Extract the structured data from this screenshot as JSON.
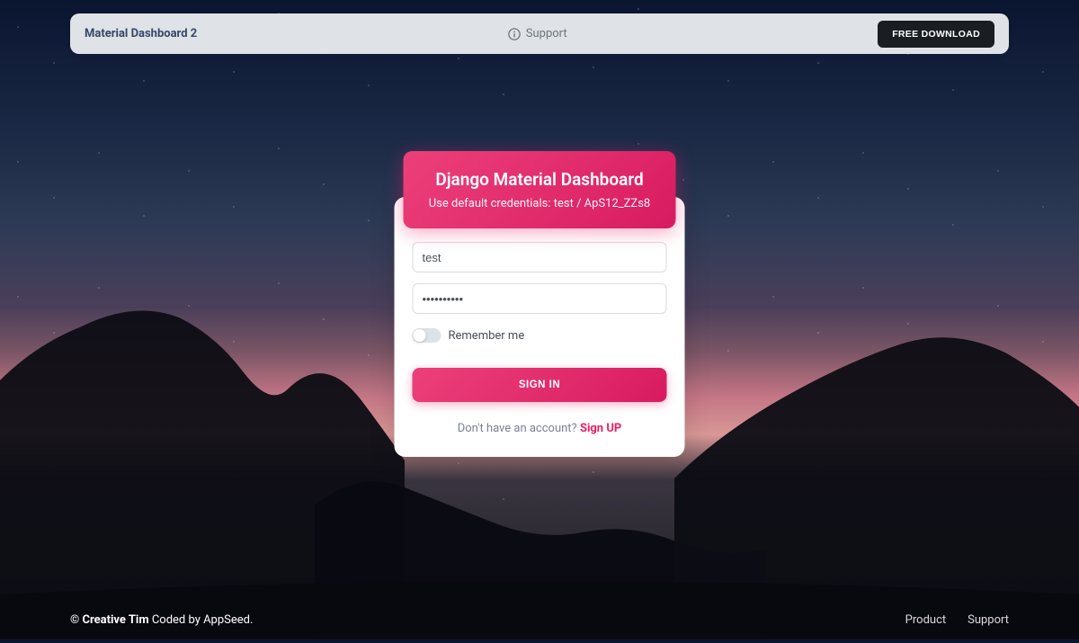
{
  "navbar": {
    "brand": "Material Dashboard 2",
    "support_label": "Support",
    "download_label": "FREE DOWNLOAD"
  },
  "login": {
    "title": "Django Material Dashboard",
    "subtitle": "Use default credentials: test / ApS12_ZZs8",
    "username_value": "test",
    "password_value": "••••••••••",
    "remember_label": "Remember me",
    "signin_label": "SIGN IN",
    "signup_prompt": "Don't have an account? ",
    "signup_link": "Sign UP"
  },
  "footer": {
    "copyright_symbol": "© ",
    "brand": "Creative Tim",
    "coded_by": " Coded by AppSeed.",
    "links": {
      "product": "Product",
      "support": "Support"
    }
  }
}
